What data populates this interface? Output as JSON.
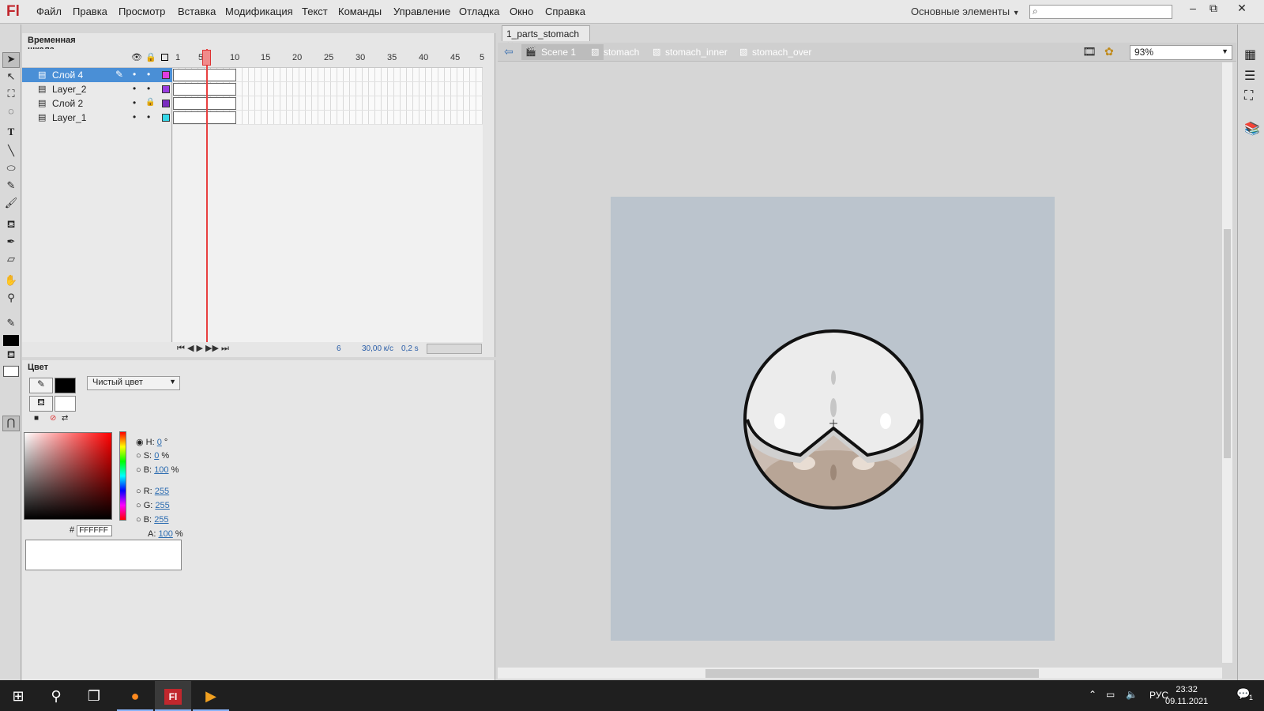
{
  "app": {
    "logo": "Fl"
  },
  "menu": [
    "Файл",
    "Правка",
    "Просмотр",
    "Вставка",
    "Модификация",
    "Текст",
    "Команды",
    "Управление",
    "Отладка",
    "Окно",
    "Справка"
  ],
  "workspace_label": "Основные элементы",
  "window_buttons": [
    "–",
    "⧉",
    "✕"
  ],
  "timeline": {
    "tab_label": "Временная шкала",
    "ticks": [
      "1",
      "5",
      "10",
      "15",
      "20",
      "25",
      "30",
      "35",
      "40",
      "45",
      "5"
    ],
    "layers": [
      {
        "name": "Слой 4",
        "color": "#e03ce0",
        "selected": true
      },
      {
        "name": "Layer_2",
        "color": "#9a3ce0",
        "selected": false
      },
      {
        "name": "Слой 2",
        "color": "#7a2cc0",
        "selected": false,
        "locked": true
      },
      {
        "name": "Layer_1",
        "color": "#35d8e8",
        "selected": false
      }
    ],
    "footer": {
      "frame": "6",
      "fps": "30,00 к/с",
      "time": "0,2 s"
    }
  },
  "color_panel": {
    "tab_label": "Цвет",
    "fill_type": "Чистый цвет",
    "H": {
      "label": "H:",
      "value": "0",
      "unit": "°"
    },
    "S": {
      "label": "S:",
      "value": "0",
      "unit": "%"
    },
    "Bv": {
      "label": "B:",
      "value": "100",
      "unit": "%"
    },
    "R": {
      "label": "R:",
      "value": "255"
    },
    "G": {
      "label": "G:",
      "value": "255"
    },
    "B": {
      "label": "B:",
      "value": "255"
    },
    "A": {
      "label": "A:",
      "value": "100",
      "unit": "%"
    },
    "hex_prefix": "#",
    "hex": "FFFFFF"
  },
  "document": {
    "tab_label": "1_parts_stomach",
    "breadcrumbs": [
      "Scene 1",
      "stomach",
      "stomach_inner",
      "stomach_over"
    ],
    "zoom": "93%"
  },
  "taskbar": {
    "time": "23:32",
    "date": "09.11.2021",
    "lang": "РУС",
    "notifications": "1"
  }
}
